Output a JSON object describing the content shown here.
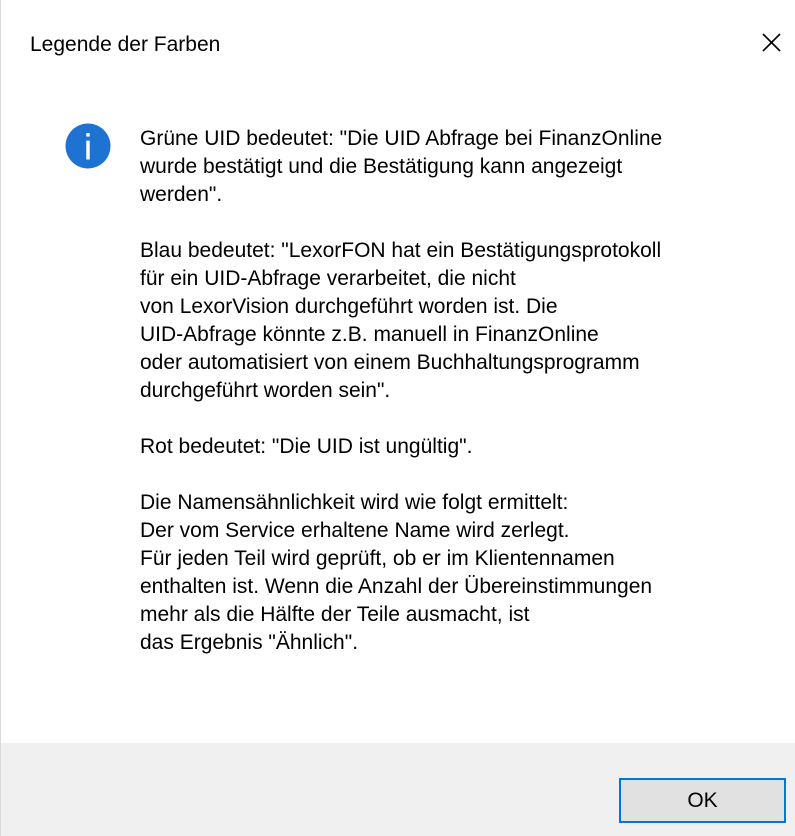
{
  "window": {
    "title": "Legende der Farben",
    "close_icon": "close-icon"
  },
  "message": {
    "icon": "info-icon",
    "icon_color": "#1e73d2",
    "paragraphs": [
      {
        "lines": [
          "Grüne UID bedeutet: \"Die UID Abfrage bei FinanzOnline",
          "wurde bestätigt und die Bestätigung kann angezeigt",
          "werden\"."
        ]
      },
      {
        "lines": [
          "Blau bedeutet: \"LexorFON hat ein Bestätigungsprotokoll",
          "für ein UID-Abfrage verarbeitet, die nicht",
          "von LexorVision durchgeführt worden ist. Die",
          "UID-Abfrage könnte z.B. manuell in FinanzOnline",
          "oder automatisiert von einem Buchhaltungsprogramm",
          "durchgeführt worden sein\"."
        ]
      },
      {
        "lines": [
          "Rot bedeutet: \"Die UID ist ungültig\"."
        ]
      },
      {
        "lines": [
          "Die Namensähnlichkeit wird wie folgt ermittelt:",
          "Der vom Service erhaltene Name wird zerlegt.",
          "Für jeden Teil wird geprüft, ob er im Klientennamen",
          "enthalten ist. Wenn die Anzahl der Übereinstimmungen",
          "mehr als die Hälfte der Teile ausmacht, ist",
          "das Ergebnis \"Ähnlich\"."
        ]
      }
    ]
  },
  "footer": {
    "ok_label": "OK",
    "accent_color": "#0078d7"
  }
}
